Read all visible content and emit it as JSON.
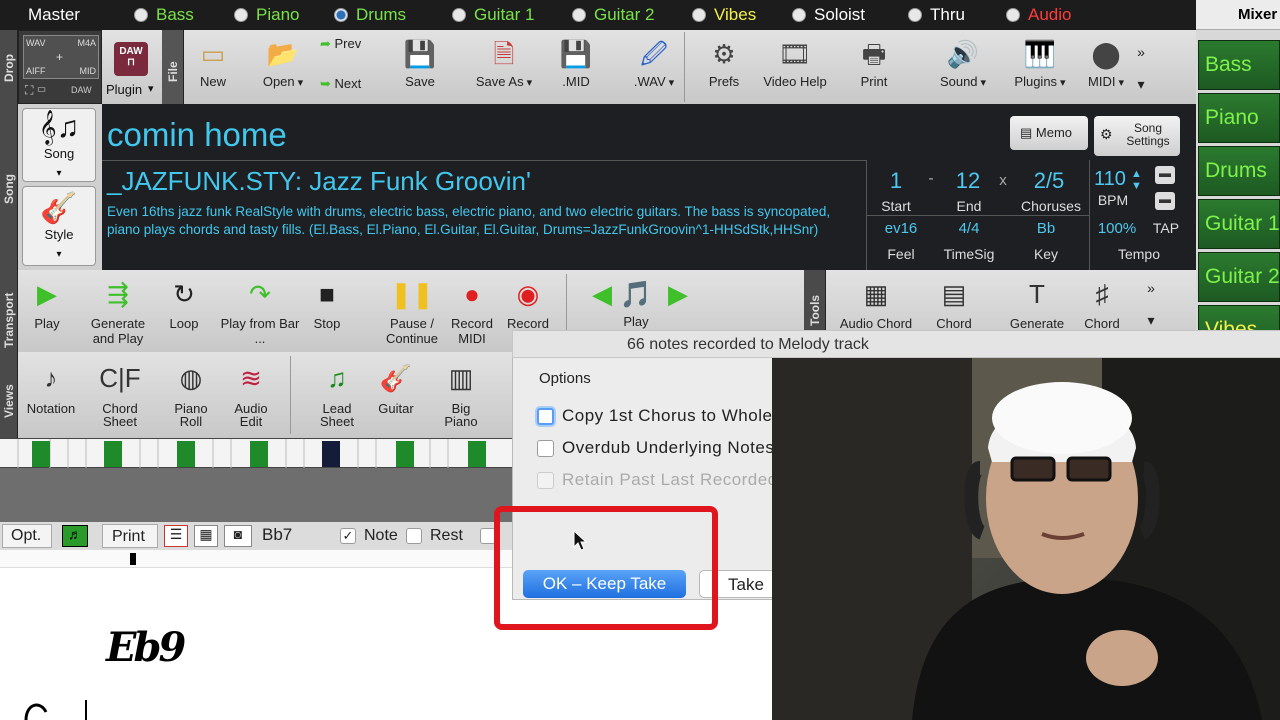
{
  "tracks": [
    {
      "label": "Master",
      "color": "#ffffff",
      "radio": "none"
    },
    {
      "label": "Bass",
      "color": "#79e24a",
      "radio": "off"
    },
    {
      "label": "Piano",
      "color": "#79e24a",
      "radio": "off"
    },
    {
      "label": "Drums",
      "color": "#79e24a",
      "radio": "on"
    },
    {
      "label": "Guitar 1",
      "color": "#79e24a",
      "radio": "off"
    },
    {
      "label": "Guitar 2",
      "color": "#79e24a",
      "radio": "off"
    },
    {
      "label": "Vibes",
      "color": "#f4f04a",
      "radio": "off"
    },
    {
      "label": "Soloist",
      "color": "#ffffff",
      "radio": "off"
    },
    {
      "label": "Thru",
      "color": "#ffffff",
      "radio": "off"
    },
    {
      "label": "Audio",
      "color": "#ff3b3b",
      "radio": "off"
    }
  ],
  "mixer": {
    "title": "Mixer",
    "tracks": [
      "Bass",
      "Piano",
      "Drums",
      "Guitar 1",
      "Guitar 2",
      "Vibes"
    ]
  },
  "side_tabs": {
    "drop": "Drop",
    "file": "File",
    "song": "Song",
    "transport": "Transport",
    "views": "Views",
    "tools": "Tools"
  },
  "drop_box": {
    "wav": "WAV",
    "m4a": "M4A",
    "aiff": "AIFF",
    "mid": "MID",
    "daw": "DAW",
    "plus": "+"
  },
  "daw_plugin": {
    "icon_text": "DAW",
    "label": "Plugin"
  },
  "file_toolbar": [
    {
      "label": "New",
      "icon": "new-icon"
    },
    {
      "label": "Open",
      "icon": "open-folder-icon",
      "arrow": true
    },
    {
      "label": "Save",
      "icon": "save-disk-icon"
    },
    {
      "label": "Save As",
      "icon": "save-as-icon",
      "arrow": true
    },
    {
      "label": ".MID",
      "icon": "midi-disk-icon"
    },
    {
      "label": ".WAV",
      "icon": "wav-disk-icon",
      "arrow": true
    },
    {
      "label": "Prefs",
      "icon": "gear-icon"
    },
    {
      "label": "Video Help",
      "icon": "film-icon"
    },
    {
      "label": "Print",
      "icon": "printer-icon"
    },
    {
      "label": "Sound",
      "icon": "speaker-icon",
      "arrow": true
    },
    {
      "label": "Plugins",
      "icon": "plugins-icon",
      "arrow": true
    },
    {
      "label": "MIDI",
      "icon": "midi-port-icon",
      "arrow": true
    }
  ],
  "prev_label": "Prev",
  "next_label": "Next",
  "more_glyph": "»",
  "down_glyph": "▾",
  "song_buttons": {
    "song": "Song",
    "style": "Style"
  },
  "song": {
    "title": "comin home",
    "style_name": "_JAZFUNK.STY: Jazz Funk Groovin'",
    "description": "Even 16ths jazz funk RealStyle with drums, electric bass, electric piano, and two electric guitars. The bass is syncopated, piano plays chords and tasty fills.    (El.Bass, El.Piano, El.Guitar, El.Guitar, Drums=JazzFunkGroovin^1-HHSdStk,HHSnr)",
    "memo": "Memo",
    "song_settings": "Song Settings"
  },
  "info": {
    "start": "1",
    "dash": "-",
    "end": "12",
    "x": "x",
    "choruses": "2/5",
    "start_label": "Start",
    "end_label": "End",
    "choruses_label": "Choruses",
    "feel": "ev16",
    "timesig": "4/4",
    "key": "Bb",
    "feel_label": "Feel",
    "timesig_label": "TimeSig",
    "key_label": "Key",
    "tempo": "110",
    "bpm": "BPM",
    "tempo_pct": "100%",
    "tap": "TAP",
    "tempo_label": "Tempo"
  },
  "transport": [
    {
      "label": "Play",
      "icon": "play-icon"
    },
    {
      "label": "Generate and Play",
      "icon": "generate-play-icon"
    },
    {
      "label": "Loop",
      "icon": "loop-icon"
    },
    {
      "label": "Play from Bar ...",
      "icon": "play-from-bar-icon"
    },
    {
      "label": "Stop",
      "icon": "stop-icon"
    },
    {
      "label": "Pause / Continue",
      "icon": "pause-icon"
    },
    {
      "label": "Record MIDI",
      "icon": "record-icon"
    },
    {
      "label": "Record",
      "icon": "record-audio-icon"
    }
  ],
  "playlist_play": "Play",
  "tools": [
    {
      "label": "Audio Chord",
      "icon": "audio-chord-icon"
    },
    {
      "label": "Chord",
      "icon": "chord-icon"
    },
    {
      "label": "Generate",
      "icon": "generate-icon"
    },
    {
      "label": "Chord Builder",
      "icon": "chord-builder-icon"
    }
  ],
  "views": [
    {
      "label": "Notation",
      "icon": "notation-icon"
    },
    {
      "label": "Chord Sheet",
      "icon": "chord-sheet-icon"
    },
    {
      "label": "Piano Roll",
      "icon": "piano-roll-icon"
    },
    {
      "label": "Audio Edit",
      "icon": "audio-edit-icon"
    },
    {
      "label": "Lead Sheet",
      "icon": "lead-sheet-icon"
    },
    {
      "label": "Guitar",
      "icon": "guitar-icon"
    },
    {
      "label": "Big Piano",
      "icon": "big-piano-icon"
    }
  ],
  "notation_bar": {
    "opt": "Opt.",
    "print": "Print",
    "chord": "Bb7",
    "note": "Note",
    "rest": "Rest"
  },
  "notation": {
    "chord_symbol": "Eb9"
  },
  "dialog": {
    "title": "66 notes recorded to Melody track",
    "options_label": "Options",
    "opt1": "Copy 1st Chorus to Whole",
    "opt2": "Overdub Underlying Notes",
    "opt3": "Retain Past Last Recorded",
    "ok": "OK – Keep Take",
    "take": "Take"
  },
  "highlight_color": "#e0161e"
}
